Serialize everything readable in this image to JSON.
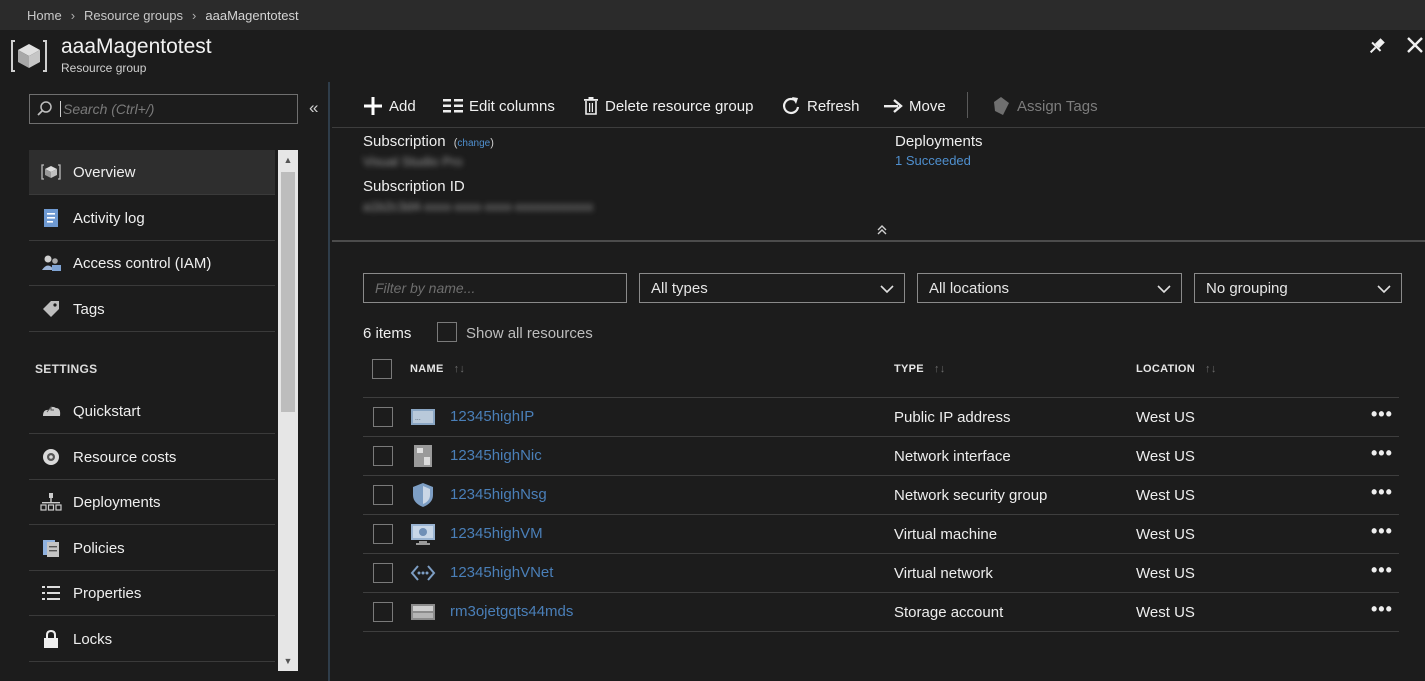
{
  "breadcrumb": [
    "Home",
    "Resource groups",
    "aaaMagentotest"
  ],
  "header": {
    "title": "aaaMagentotest",
    "subtitle": "Resource group"
  },
  "search": {
    "placeholder": "Search (Ctrl+/)",
    "value": ""
  },
  "sidebar": {
    "collapse_glyph": "«",
    "items": [
      {
        "label": "Overview",
        "icon": "overview-icon",
        "active": true
      },
      {
        "label": "Activity log",
        "icon": "activity-log-icon"
      },
      {
        "label": "Access control (IAM)",
        "icon": "iam-icon"
      },
      {
        "label": "Tags",
        "icon": "tag-icon"
      }
    ],
    "settings_label": "SETTINGS",
    "settings_items": [
      {
        "label": "Quickstart",
        "icon": "quickstart-icon"
      },
      {
        "label": "Resource costs",
        "icon": "resource-costs-icon"
      },
      {
        "label": "Deployments",
        "icon": "deployments-icon"
      },
      {
        "label": "Policies",
        "icon": "policies-icon"
      },
      {
        "label": "Properties",
        "icon": "properties-icon"
      },
      {
        "label": "Locks",
        "icon": "lock-icon"
      }
    ]
  },
  "toolbar": {
    "add": "Add",
    "edit_columns": "Edit columns",
    "delete": "Delete resource group",
    "refresh": "Refresh",
    "move": "Move",
    "assign_tags": "Assign Tags"
  },
  "essentials": {
    "subscription_label": "Subscription",
    "change_link": "change",
    "subscription_value": "Visual Studio Pro",
    "subscription_id_label": "Subscription ID",
    "subscription_id_value": "a1b2c3d4-xxxx-xxxx-xxxx-xxxxxxxxxxxx",
    "deployments_label": "Deployments",
    "deployments_value": "1 Succeeded"
  },
  "filters": {
    "name_placeholder": "Filter by name...",
    "types": "All types",
    "locations": "All locations",
    "grouping": "No grouping"
  },
  "list": {
    "count": "6 items",
    "show_all": "Show all resources",
    "columns": {
      "name": "NAME",
      "type": "TYPE",
      "location": "LOCATION"
    },
    "sort_glyph": "↑↓",
    "more_glyph": "•••",
    "rows": [
      {
        "name": "12345highIP",
        "type": "Public IP address",
        "location": "West US",
        "icon": "public-ip-icon"
      },
      {
        "name": "12345highNic",
        "type": "Network interface",
        "location": "West US",
        "icon": "network-interface-icon"
      },
      {
        "name": "12345highNsg",
        "type": "Network security group",
        "location": "West US",
        "icon": "nsg-shield-icon"
      },
      {
        "name": "12345highVM",
        "type": "Virtual machine",
        "location": "West US",
        "icon": "virtual-machine-icon"
      },
      {
        "name": "12345highVNet",
        "type": "Virtual network",
        "location": "West US",
        "icon": "vnet-icon"
      },
      {
        "name": "rm3ojetgqts44mds",
        "type": "Storage account",
        "location": "West US",
        "icon": "storage-account-icon"
      }
    ]
  },
  "colors": {
    "background": "#1c1c1c",
    "link": "#4a7fb8",
    "accent_border": "#2f3d4a"
  }
}
